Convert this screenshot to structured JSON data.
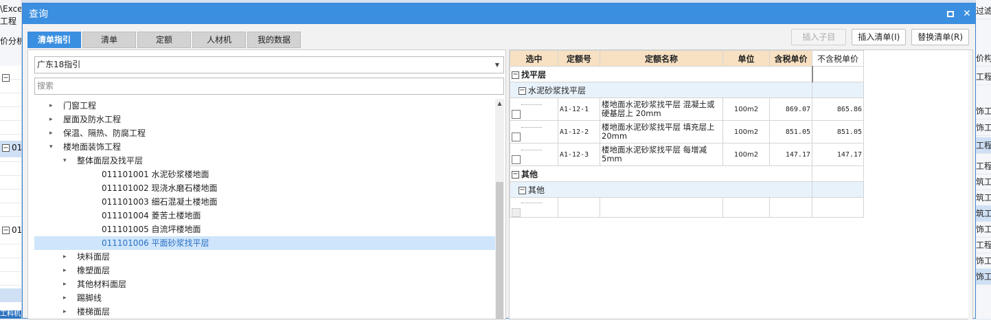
{
  "background": {
    "left_texts": [
      "\\Exce",
      "工程",
      "价分析",
      "01",
      "01",
      "工料机"
    ],
    "right_texts": [
      "过滤",
      "价构",
      "工程",
      "饰工程",
      "饰工程",
      "工程",
      "工程",
      "筑工程",
      "筑工程",
      "筑工程",
      "饰工程",
      "工程",
      "饰工程",
      "饰工程"
    ]
  },
  "dialog": {
    "title": "查询",
    "tabs": [
      "清单指引",
      "清单",
      "定额",
      "人材机",
      "我的数据"
    ],
    "buttons": {
      "insert_child": "插入子目",
      "insert_list": "插入清单(I)",
      "replace_list": "替换清单(R)"
    },
    "left": {
      "selected_guide": "广东18指引",
      "search_placeholder": "搜索",
      "tree": [
        {
          "label": "门窗工程",
          "level": 0,
          "toggle": "▸"
        },
        {
          "label": "屋面及防水工程",
          "level": 0,
          "toggle": "▸"
        },
        {
          "label": "保温、隔热、防腐工程",
          "level": 0,
          "toggle": "▸"
        },
        {
          "label": "楼地面装饰工程",
          "level": 0,
          "toggle": "▾"
        },
        {
          "label": "整体面层及找平层",
          "level": 1,
          "toggle": "▾"
        },
        {
          "label": "011101001  水泥砂浆楼地面",
          "level": 2,
          "toggle": ""
        },
        {
          "label": "011101002  现浇水磨石楼地面",
          "level": 2,
          "toggle": ""
        },
        {
          "label": "011101003  细石混凝土楼地面",
          "level": 2,
          "toggle": ""
        },
        {
          "label": "011101004  菱苦土楼地面",
          "level": 2,
          "toggle": ""
        },
        {
          "label": "011101005  自流坪楼地面",
          "level": 2,
          "toggle": ""
        },
        {
          "label": "011101006  平面砂浆找平层",
          "level": 2,
          "toggle": "",
          "selected": true
        },
        {
          "label": "块料面层",
          "level": 1,
          "toggle": "▸"
        },
        {
          "label": "橡塑面层",
          "level": 1,
          "toggle": "▸"
        },
        {
          "label": "其他材料面层",
          "level": 1,
          "toggle": "▸"
        },
        {
          "label": "踢脚线",
          "level": 1,
          "toggle": "▸"
        },
        {
          "label": "楼梯面层",
          "level": 1,
          "toggle": "▸"
        }
      ]
    },
    "right": {
      "columns": [
        "选中",
        "定额号",
        "定额名称",
        "单位",
        "含税单价",
        "不含税单价"
      ],
      "group1": "找平层",
      "group1_sub": "水泥砂浆找平层",
      "rows": [
        {
          "code": "A1-12-1",
          "name": "楼地面水泥砂浆找平层 混凝土或硬基层上 20mm",
          "unit": "100m2",
          "tax_price": "869.07",
          "notax_price": "865.86"
        },
        {
          "code": "A1-12-2",
          "name": "楼地面水泥砂浆找平层 填充层上20mm",
          "unit": "100m2",
          "tax_price": "851.05",
          "notax_price": "851.05"
        },
        {
          "code": "A1-12-3",
          "name": "楼地面水泥砂浆找平层 每增减5mm",
          "unit": "100m2",
          "tax_price": "147.17",
          "notax_price": "147.17"
        }
      ],
      "group2": "其他",
      "group2_sub": "其他"
    }
  }
}
